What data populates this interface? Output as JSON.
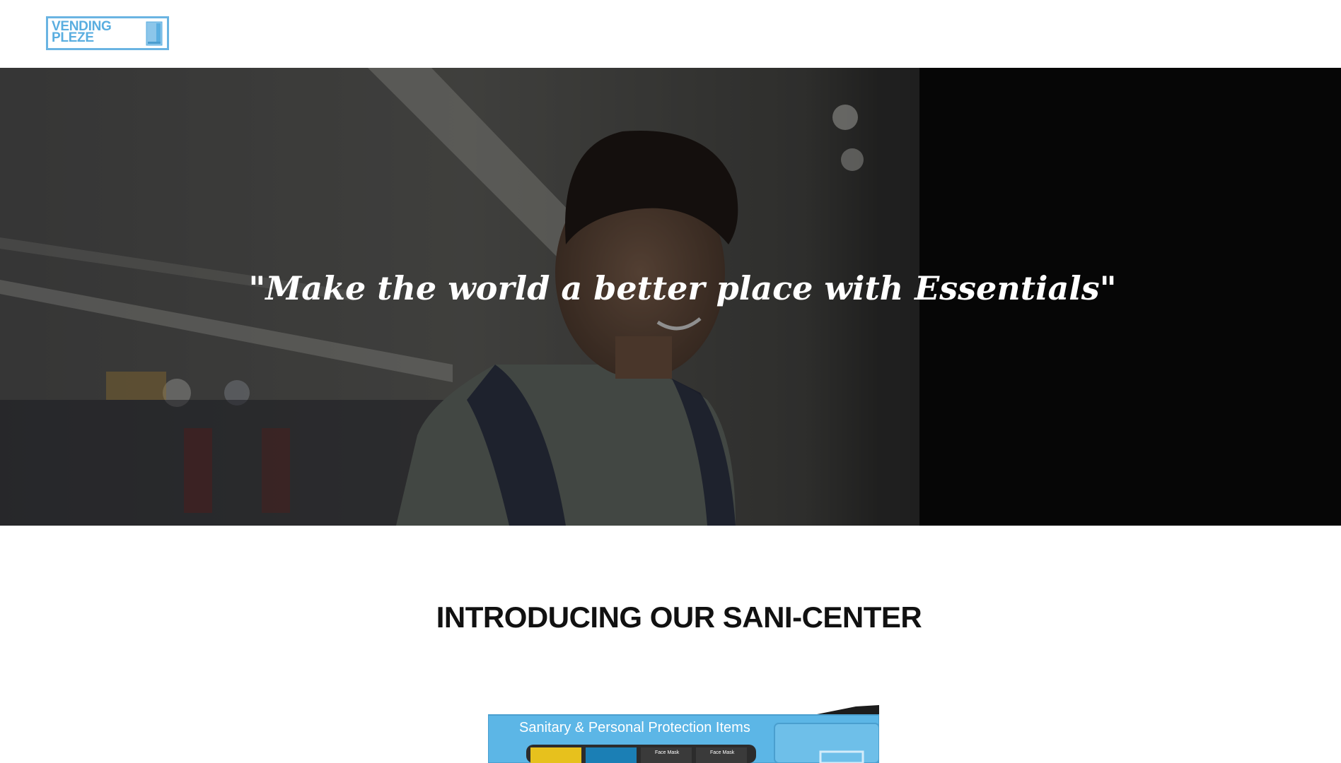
{
  "header": {
    "logo": {
      "line1": "VENDING",
      "line2": "PLEZE",
      "icon": "vending-machine-icon",
      "color": "#5aaee0"
    }
  },
  "hero": {
    "quote": "\"Make the world a better place with Essentials\""
  },
  "section": {
    "title": "INTRODUCING OUR SANI-CENTER"
  },
  "product": {
    "banner_text": "Sanitary & Personal Protection Items",
    "item_labels": [
      "Face Mask",
      "Face Mask"
    ],
    "accent": "#5cb6e6"
  }
}
